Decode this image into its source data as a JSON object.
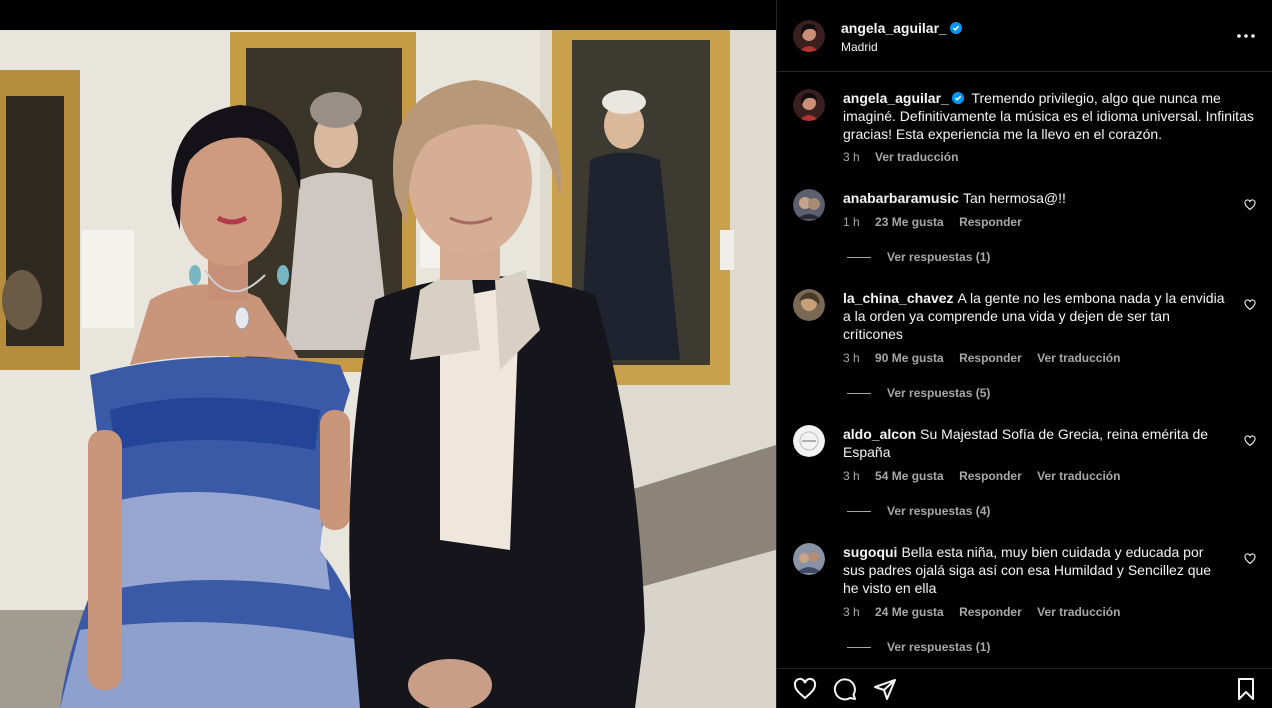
{
  "post": {
    "author": "angela_aguilar_",
    "location": "Madrid"
  },
  "caption": {
    "username": "angela_aguilar_",
    "text": "Tremendo privilegio, algo que nunca me imaginé. Definitivamente la música es el idioma universal. Infinitas gracias! Esta experiencia me la llevo en el corazón.",
    "time": "3 h",
    "translate": "Ver traducción"
  },
  "comments": [
    {
      "username": "anabarbaramusic",
      "text": "Tan hermosa@!!",
      "time": "1 h",
      "likes": "23 Me gusta",
      "reply": "Responder",
      "translate": "",
      "replies": "Ver respuestas (1)"
    },
    {
      "username": "la_china_chavez",
      "text": "A la gente no les embona nada y la envidia a la orden ya comprende una vida y dejen de ser tan críticones",
      "time": "3 h",
      "likes": "90 Me gusta",
      "reply": "Responder",
      "translate": "Ver traducción",
      "replies": "Ver respuestas (5)"
    },
    {
      "username": "aldo_alcon",
      "text": "Su Majestad Sofía de Grecia, reina emérita de España",
      "time": "3 h",
      "likes": "54 Me gusta",
      "reply": "Responder",
      "translate": "Ver traducción",
      "replies": "Ver respuestas (4)"
    },
    {
      "username": "sugoqui",
      "text": "Bella esta niña, muy bien cuidada y educada por sus padres ojalá siga así con esa Humildad y Sencillez que he visto en ella",
      "time": "3 h",
      "likes": "24 Me gusta",
      "reply": "Responder",
      "translate": "Ver traducción",
      "replies": "Ver respuestas (1)"
    }
  ],
  "icons": {
    "verified": "verified-badge-icon",
    "more": "more-options-icon",
    "like": "heart-icon",
    "comment": "comment-icon",
    "share": "share-icon",
    "save": "bookmark-icon"
  },
  "colors": {
    "background": "#000000",
    "text": "#f5f5f5",
    "secondary": "#a8a8a8",
    "verified": "#0095f6",
    "divider": "#262626"
  }
}
